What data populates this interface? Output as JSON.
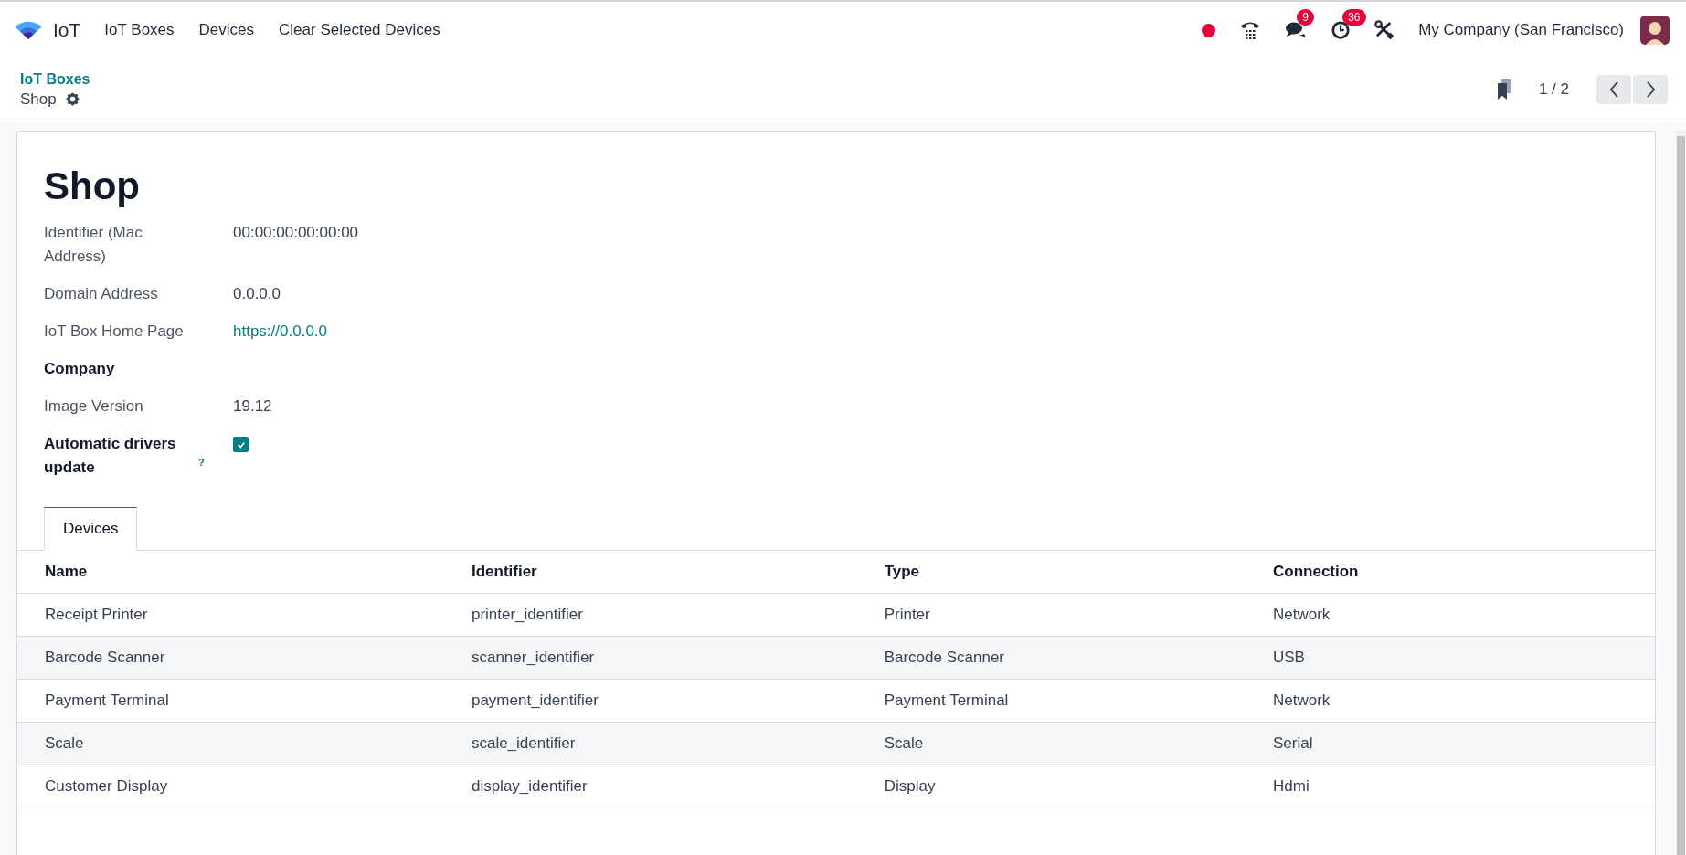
{
  "navbar": {
    "app_name": "IoT",
    "menu": [
      {
        "label": "IoT Boxes"
      },
      {
        "label": "Devices"
      },
      {
        "label": "Clear Selected Devices"
      }
    ],
    "systray": [
      {
        "kind": "record"
      },
      {
        "kind": "phone"
      },
      {
        "kind": "chat",
        "badge": "9"
      },
      {
        "kind": "clock",
        "badge": "36"
      },
      {
        "kind": "tools"
      }
    ],
    "company": "My Company (San Francisco)"
  },
  "breadcrumb": {
    "parent": "IoT Boxes",
    "current": "Shop"
  },
  "pager": {
    "value": "1 / 2"
  },
  "record": {
    "title": "Shop",
    "fields": [
      {
        "label": "Identifier (Mac Address)",
        "bold": false,
        "kind": "text",
        "value": "00:00:00:00:00:00"
      },
      {
        "label": "Domain Address",
        "bold": false,
        "kind": "text",
        "value": "0.0.0.0"
      },
      {
        "label": "IoT Box Home Page",
        "bold": false,
        "kind": "link",
        "value": "https://0.0.0.0"
      },
      {
        "label": "Company",
        "bold": true,
        "kind": "empty"
      },
      {
        "label": "Image Version",
        "bold": false,
        "kind": "text",
        "value": "19.12"
      },
      {
        "label": "Automatic drivers update",
        "help": "?",
        "bold": true,
        "kind": "checkbox",
        "checked": true
      }
    ]
  },
  "tabs": [
    {
      "label": "Devices",
      "selected": true
    }
  ],
  "table": {
    "columns": [
      "Name",
      "Identifier",
      "Type",
      "Connection"
    ],
    "rows": [
      [
        "Receipt Printer",
        "printer_identifier",
        "Printer",
        "Network"
      ],
      [
        "Barcode Scanner",
        "scanner_identifier",
        "Barcode Scanner",
        "USB"
      ],
      [
        "Payment Terminal",
        "payment_identifier",
        "Payment Terminal",
        "Network"
      ],
      [
        "Scale",
        "scale_identifier",
        "Scale",
        "Serial"
      ],
      [
        "Customer Display",
        "display_identifier",
        "Display",
        "Hdmi"
      ]
    ]
  }
}
